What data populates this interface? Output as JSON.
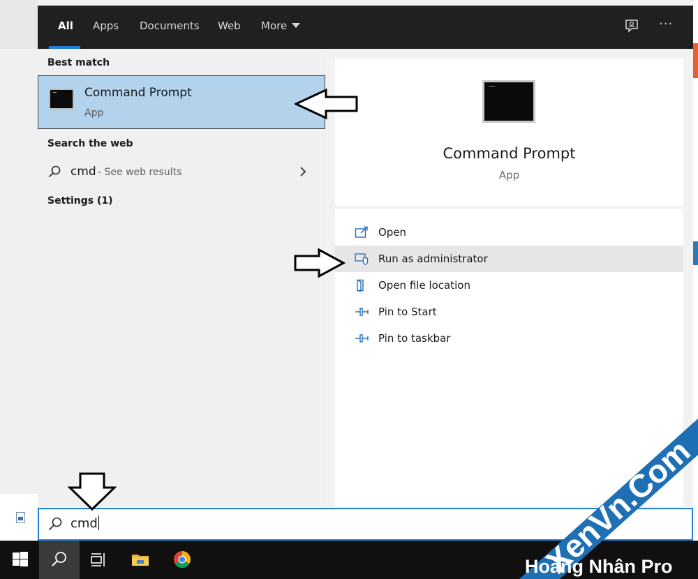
{
  "tabs": {
    "all": "All",
    "apps": "Apps",
    "documents": "Documents",
    "web": "Web",
    "more": "More"
  },
  "best_match": {
    "heading": "Best match",
    "title": "Command Prompt",
    "subtitle": "App"
  },
  "search_web": {
    "heading": "Search the web",
    "query": "cmd",
    "hint": "- See web results"
  },
  "settings": {
    "heading": "Settings (1)"
  },
  "preview": {
    "title": "Command Prompt",
    "subtitle": "App"
  },
  "actions": [
    {
      "label": "Open",
      "icon": "open-window-icon"
    },
    {
      "label": "Run as administrator",
      "icon": "shield-icon"
    },
    {
      "label": "Open file location",
      "icon": "folder-location-icon"
    },
    {
      "label": "Pin to Start",
      "icon": "pin-icon"
    },
    {
      "label": "Pin to taskbar",
      "icon": "pin-icon"
    }
  ],
  "search_box": {
    "value": "cmd"
  },
  "taskbar": {
    "items": [
      "windows-start-icon",
      "search-icon",
      "task-view-icon",
      "file-explorer-icon",
      "chrome-icon"
    ]
  },
  "watermark": {
    "brand": "XenVn.Com",
    "footer": "Hoàng Nhân Pro"
  },
  "colors": {
    "accent": "#1f7fd8",
    "selection": "#b3d3ed",
    "topbar": "#202020",
    "taskbar": "#101010"
  }
}
